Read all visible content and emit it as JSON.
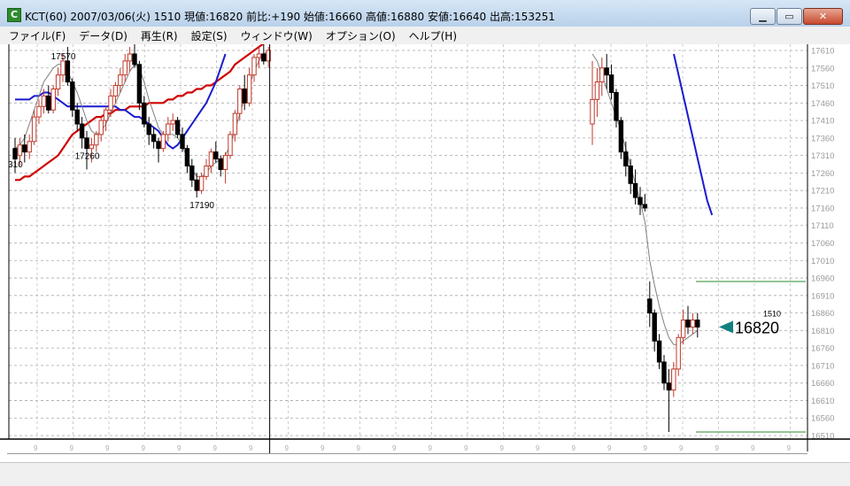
{
  "window": {
    "icon_letter": "C",
    "title": "KCT(60) 2007/03/06(火) 1510 現値:16820 前比:+190 始値:16660 高値:16880 安値:16640 出高:153251",
    "minimize_label": "▁",
    "maximize_label": "▭",
    "close_label": "✕"
  },
  "menu": {
    "items": [
      "ファイル(F)",
      "データ(D)",
      "再生(R)",
      "設定(S)",
      "ウィンドウ(W)",
      "オプション(O)",
      "ヘルプ(H)"
    ]
  },
  "chart_data": {
    "type": "candlestick",
    "symbol": "KCT(60)",
    "ylim": [
      16510,
      17630
    ],
    "yticks": [
      17610,
      17560,
      17510,
      17460,
      17410,
      17360,
      17310,
      17260,
      17210,
      17160,
      17110,
      17060,
      17010,
      16960,
      16910,
      16860,
      16810,
      16760,
      16710,
      16660,
      16610,
      16560,
      16510
    ],
    "grid": true,
    "colors": {
      "up": "#c0392b",
      "down": "#000000",
      "ma_short": "#808080",
      "ma_mid": "#1a1ad0",
      "ma_long": "#d00000",
      "marker": "#138080",
      "level": "#2e8b2e"
    },
    "annotations": [
      {
        "text": "17570",
        "index": 9
      },
      {
        "text": "310",
        "index": 0
      },
      {
        "text": "17260",
        "index": 14
      },
      {
        "text": "17190",
        "index": 38
      }
    ],
    "last_price": {
      "label": "16820",
      "time": "1510",
      "value": 16820
    },
    "level_lines": [
      16950,
      16520
    ],
    "vertical_marker_index": 44,
    "candles_left": [
      [
        17330,
        17360,
        17260,
        17300
      ],
      [
        17310,
        17360,
        17280,
        17340
      ],
      [
        17340,
        17370,
        17290,
        17320
      ],
      [
        17320,
        17370,
        17300,
        17350
      ],
      [
        17350,
        17440,
        17340,
        17420
      ],
      [
        17420,
        17470,
        17400,
        17450
      ],
      [
        17450,
        17500,
        17430,
        17480
      ],
      [
        17480,
        17510,
        17430,
        17440
      ],
      [
        17440,
        17510,
        17430,
        17500
      ],
      [
        17500,
        17560,
        17480,
        17540
      ],
      [
        17540,
        17600,
        17520,
        17580
      ],
      [
        17580,
        17620,
        17510,
        17520
      ],
      [
        17520,
        17530,
        17420,
        17440
      ],
      [
        17440,
        17460,
        17380,
        17400
      ],
      [
        17400,
        17420,
        17330,
        17360
      ],
      [
        17360,
        17380,
        17270,
        17330
      ],
      [
        17330,
        17360,
        17290,
        17340
      ],
      [
        17340,
        17380,
        17320,
        17370
      ],
      [
        17370,
        17420,
        17350,
        17410
      ],
      [
        17410,
        17450,
        17380,
        17440
      ],
      [
        17440,
        17500,
        17420,
        17480
      ],
      [
        17480,
        17520,
        17460,
        17510
      ],
      [
        17510,
        17560,
        17490,
        17540
      ],
      [
        17540,
        17600,
        17520,
        17580
      ],
      [
        17580,
        17620,
        17550,
        17600
      ],
      [
        17600,
        17630,
        17560,
        17570
      ],
      [
        17570,
        17580,
        17440,
        17460
      ],
      [
        17460,
        17480,
        17390,
        17400
      ],
      [
        17400,
        17420,
        17340,
        17370
      ],
      [
        17370,
        17390,
        17330,
        17350
      ],
      [
        17350,
        17360,
        17290,
        17330
      ],
      [
        17330,
        17380,
        17320,
        17370
      ],
      [
        17370,
        17420,
        17350,
        17400
      ],
      [
        17400,
        17430,
        17380,
        17410
      ],
      [
        17410,
        17420,
        17360,
        17370
      ],
      [
        17370,
        17390,
        17320,
        17330
      ],
      [
        17330,
        17340,
        17260,
        17280
      ],
      [
        17280,
        17300,
        17220,
        17240
      ],
      [
        17240,
        17260,
        17190,
        17210
      ],
      [
        17210,
        17260,
        17200,
        17250
      ],
      [
        17250,
        17300,
        17240,
        17280
      ],
      [
        17280,
        17330,
        17260,
        17320
      ],
      [
        17320,
        17350,
        17290,
        17300
      ],
      [
        17300,
        17310,
        17250,
        17270
      ],
      [
        17270,
        17320,
        17230,
        17310
      ],
      [
        17310,
        17380,
        17300,
        17370
      ],
      [
        17370,
        17440,
        17350,
        17430
      ],
      [
        17430,
        17510,
        17410,
        17500
      ],
      [
        17500,
        17540,
        17440,
        17460
      ],
      [
        17460,
        17560,
        17450,
        17540
      ],
      [
        17540,
        17600,
        17520,
        17590
      ],
      [
        17590,
        17620,
        17560,
        17600
      ],
      [
        17600,
        17630,
        17570,
        17580
      ],
      [
        17580,
        17620,
        17560,
        17610
      ]
    ],
    "candles_right": [
      [
        17400,
        17580,
        17340,
        17470
      ],
      [
        17470,
        17560,
        17420,
        17520
      ],
      [
        17520,
        17590,
        17480,
        17560
      ],
      [
        17560,
        17600,
        17500,
        17540
      ],
      [
        17540,
        17570,
        17470,
        17490
      ],
      [
        17490,
        17500,
        17390,
        17410
      ],
      [
        17410,
        17420,
        17300,
        17320
      ],
      [
        17320,
        17350,
        17250,
        17280
      ],
      [
        17280,
        17300,
        17200,
        17230
      ],
      [
        17230,
        17270,
        17170,
        17190
      ],
      [
        17190,
        17220,
        17140,
        17170
      ],
      [
        17170,
        17200,
        17150,
        17160
      ],
      [
        16900,
        16950,
        16820,
        16860
      ],
      [
        16860,
        16870,
        16750,
        16780
      ],
      [
        16780,
        16800,
        16700,
        16720
      ],
      [
        16720,
        16740,
        16640,
        16660
      ],
      [
        16660,
        16700,
        16520,
        16640
      ],
      [
        16640,
        16720,
        16620,
        16700
      ],
      [
        16700,
        16800,
        16680,
        16790
      ],
      [
        16790,
        16870,
        16770,
        16840
      ],
      [
        16840,
        16880,
        16800,
        16820
      ],
      [
        16820,
        16860,
        16800,
        16840
      ],
      [
        16840,
        16860,
        16790,
        16820
      ]
    ],
    "ma_short_left": [
      17330,
      17340,
      17360,
      17400,
      17440,
      17480,
      17520,
      17540,
      17560,
      17570,
      17570,
      17550,
      17520,
      17490,
      17450,
      17410,
      17380,
      17370,
      17380,
      17400,
      17430,
      17460,
      17490,
      17520,
      17550,
      17570,
      17560,
      17520,
      17470,
      17430,
      17390,
      17370,
      17370,
      17370,
      17360,
      17340,
      17300,
      17270,
      17250,
      17250,
      17260,
      17280,
      17290,
      17300,
      17310,
      17340,
      17380,
      17430,
      17470,
      17510,
      17550,
      17580,
      17600,
      17610
    ],
    "ma_short_right": [
      17600,
      17580,
      17540,
      17500,
      17460,
      17420,
      17380,
      17330,
      17280,
      17230,
      17180,
      17120,
      17010,
      16940,
      16880,
      16830,
      16790,
      16770,
      16770,
      16780,
      16790,
      16800,
      16810
    ],
    "ma_mid_left": [
      17470,
      17470,
      17470,
      17470,
      17480,
      17480,
      17490,
      17490,
      17480,
      17470,
      17460,
      17450,
      17450,
      17450,
      17450,
      17450,
      17450,
      17450,
      17450,
      17450,
      17450,
      17450,
      17440,
      17440,
      17430,
      17420,
      17420,
      17410,
      17400,
      17390,
      17380,
      17360,
      17340,
      17330,
      17340,
      17360,
      17380,
      17400,
      17420,
      17440,
      17460,
      17490,
      17520,
      17560,
      17600
    ],
    "ma_mid_right": [
      17600,
      17540,
      17480,
      17420,
      17360,
      17300,
      17240,
      17180,
      17140
    ],
    "ma_long_left": [
      17240,
      17240,
      17250,
      17250,
      17260,
      17270,
      17280,
      17290,
      17300,
      17310,
      17330,
      17350,
      17370,
      17380,
      17390,
      17400,
      17410,
      17420,
      17420,
      17430,
      17430,
      17440,
      17440,
      17440,
      17450,
      17450,
      17450,
      17450,
      17460,
      17460,
      17460,
      17460,
      17470,
      17470,
      17480,
      17480,
      17490,
      17490,
      17500,
      17500,
      17510,
      17510,
      17520,
      17530,
      17540,
      17550,
      17570,
      17580,
      17590,
      17600,
      17610,
      17620,
      17630
    ]
  }
}
